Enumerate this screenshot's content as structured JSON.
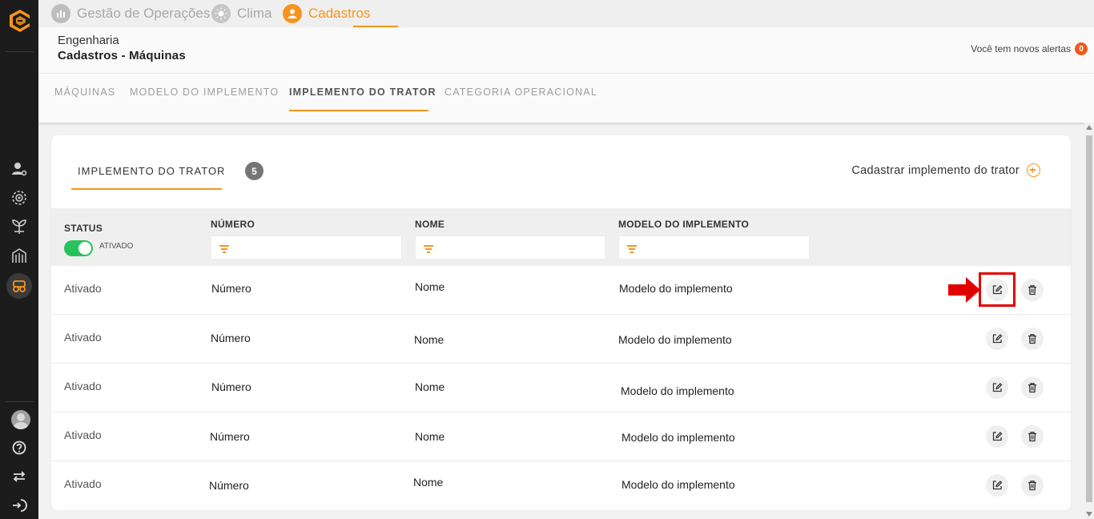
{
  "colors": {
    "accent": "#f7941d",
    "active_toggle": "#27c35a",
    "alert_badge": "#f2581d",
    "highlight": "#e30000"
  },
  "sidebar": {
    "logo": "brand-logo-icon",
    "icons": [
      "user-settings-icon",
      "gear-target-icon",
      "plant-icon",
      "building-icon",
      "tractor-icon",
      "help-icon",
      "switch-icon",
      "logout-icon"
    ]
  },
  "modules": [
    {
      "label": "Gestão de Operações",
      "icon": "chart-icon"
    },
    {
      "label": "Clima",
      "icon": "sun-icon"
    },
    {
      "label": "Cadastros",
      "icon": "user-icon",
      "active": true
    }
  ],
  "header": {
    "supertitle": "Engenharia",
    "title": "Cadastros - Máquinas",
    "alerts_label": "Você tem novos alertas",
    "alerts_count": "0"
  },
  "subtabs": [
    {
      "label": "MÁQUINAS"
    },
    {
      "label": "MODELO DO IMPLEMENTO"
    },
    {
      "label": "IMPLEMENTO DO TRATOR",
      "active": true
    },
    {
      "label": "CATEGORIA OPERACIONAL"
    }
  ],
  "card": {
    "tab_label": "IMPLEMENTO DO TRATOR",
    "count": "5",
    "add_label": "Cadastrar implemento do trator"
  },
  "table": {
    "columns": {
      "status": "STATUS",
      "numero": "NÚMERO",
      "nome": "NOME",
      "modelo": "MODELO DO IMPLEMENTO"
    },
    "status_filter": {
      "label": "ATIVADO",
      "on": true
    },
    "rows": [
      {
        "status": "Ativado",
        "numero": "Número",
        "nome": "Nome",
        "modelo": "Modelo do implemento"
      },
      {
        "status": "Ativado",
        "numero": "Número",
        "nome": "Nome",
        "modelo": "Modelo do implemento"
      },
      {
        "status": "Ativado",
        "numero": "Número",
        "nome": "Nome",
        "modelo": "Modelo do implemento"
      },
      {
        "status": "Ativado",
        "numero": "Número",
        "nome": "Nome",
        "modelo": "Modelo do implemento"
      },
      {
        "status": "Ativado",
        "numero": "Número",
        "nome": "Nome",
        "modelo": "Modelo do implemento"
      }
    ]
  }
}
